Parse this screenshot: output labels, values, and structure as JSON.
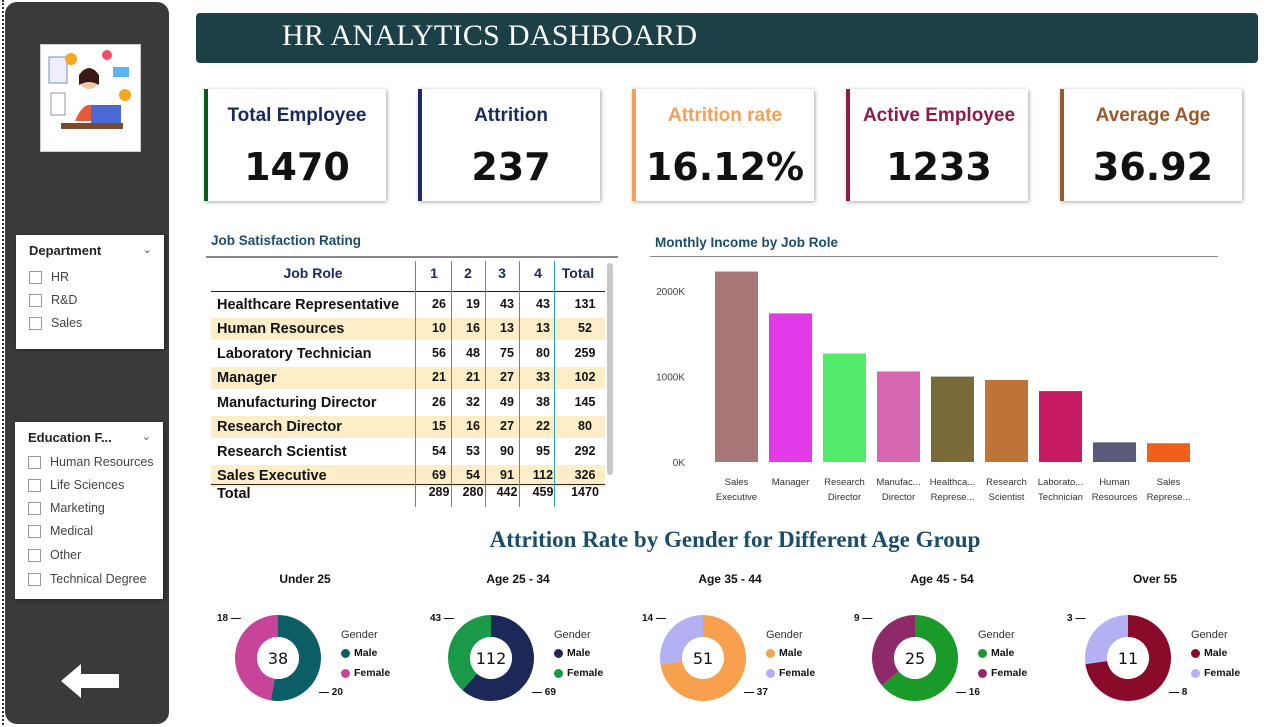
{
  "header": {
    "title": "HR ANALYTICS DASHBOARD"
  },
  "kpis": [
    {
      "label": "Total Employee",
      "value": "1470",
      "color": "#0c5a1e"
    },
    {
      "label": "Attrition",
      "value": "237",
      "color": "#1a2a6b"
    },
    {
      "label": "Attrition rate",
      "value": "16.12%",
      "color": "#f3a05a"
    },
    {
      "label": "Active Employee",
      "value": "1233",
      "color": "#8c1c4a"
    },
    {
      "label": "Average Age",
      "value": "36.92",
      "color": "#9c5a2a"
    }
  ],
  "slicers": {
    "department": {
      "title": "Department",
      "options": [
        "HR",
        "R&D",
        "Sales"
      ]
    },
    "education": {
      "title": "Education F...",
      "options": [
        "Human Resources",
        "Life Sciences",
        "Marketing",
        "Medical",
        "Other",
        "Technical Degree"
      ]
    }
  },
  "job_satisfaction": {
    "title": "Job Satisfaction Rating",
    "headers": [
      "Job Role",
      "1",
      "2",
      "3",
      "4",
      "Total"
    ],
    "rows": [
      {
        "role": "Healthcare Representative",
        "v": [
          "26",
          "19",
          "43",
          "43",
          "131"
        ]
      },
      {
        "role": "Human Resources",
        "v": [
          "10",
          "16",
          "13",
          "13",
          "52"
        ]
      },
      {
        "role": "Laboratory Technician",
        "v": [
          "56",
          "48",
          "75",
          "80",
          "259"
        ]
      },
      {
        "role": "Manager",
        "v": [
          "21",
          "21",
          "27",
          "33",
          "102"
        ]
      },
      {
        "role": "Manufacturing Director",
        "v": [
          "26",
          "32",
          "49",
          "38",
          "145"
        ]
      },
      {
        "role": "Research Director",
        "v": [
          "15",
          "16",
          "27",
          "22",
          "80"
        ]
      },
      {
        "role": "Research Scientist",
        "v": [
          "54",
          "53",
          "90",
          "95",
          "292"
        ]
      },
      {
        "role": "Sales Executive",
        "v": [
          "69",
          "54",
          "91",
          "112",
          "326"
        ]
      }
    ],
    "total": {
      "role": "Total",
      "v": [
        "289",
        "280",
        "442",
        "459",
        "1470"
      ]
    }
  },
  "chart_data": [
    {
      "type": "bar",
      "title": "Monthly Income by Job Role",
      "categories": [
        [
          "Sales",
          "Executive"
        ],
        [
          "Manager",
          ""
        ],
        [
          "Research",
          "Director"
        ],
        [
          "Manufac...",
          "Director"
        ],
        [
          "Healthca...",
          "Represe..."
        ],
        [
          "Research",
          "Scientist"
        ],
        [
          "Laborato...",
          "Technician"
        ],
        [
          "Human",
          "Resources"
        ],
        [
          "Sales",
          "Represe..."
        ]
      ],
      "values": [
        2230000,
        1740000,
        1270000,
        1060000,
        1000000,
        960000,
        830000,
        230000,
        220000
      ],
      "colors": [
        "#a87878",
        "#e23ae6",
        "#52ec6a",
        "#d666b0",
        "#7a6a38",
        "#c07338",
        "#c61a62",
        "#5a5a7a",
        "#f0601a"
      ],
      "yticks": [
        {
          "v": 0,
          "label": "0K"
        },
        {
          "v": 1000000,
          "label": "1000K"
        },
        {
          "v": 2000000,
          "label": "2000K"
        }
      ],
      "ylim": [
        0,
        2400000
      ]
    },
    {
      "type": "pie",
      "title": "Attrition Rate by Gender for Different Age Group",
      "groups": [
        {
          "title": "Under 25",
          "total": "38",
          "slices": [
            {
              "name": "Male",
              "value": 20,
              "color": "#0b5e63"
            },
            {
              "name": "Female",
              "value": 18,
              "color": "#c8439a"
            }
          ]
        },
        {
          "title": "Age 25 - 34",
          "total": "112",
          "slices": [
            {
              "name": "Male",
              "value": 69,
              "color": "#1c2858"
            },
            {
              "name": "Female",
              "value": 43,
              "color": "#1a9a48"
            }
          ]
        },
        {
          "title": "Age 35 - 44",
          "total": "51",
          "slices": [
            {
              "name": "Male",
              "value": 37,
              "color": "#f7a04e"
            },
            {
              "name": "Female",
              "value": 14,
              "color": "#b4b0f4"
            }
          ]
        },
        {
          "title": "Age 45 - 54",
          "total": "25",
          "slices": [
            {
              "name": "Male",
              "value": 16,
              "color": "#1a9a28"
            },
            {
              "name": "Female",
              "value": 9,
              "color": "#8e2a6a"
            }
          ]
        },
        {
          "title": "Over 55",
          "total": "11",
          "slices": [
            {
              "name": "Male",
              "value": 8,
              "color": "#8a0a2a"
            },
            {
              "name": "Female",
              "value": 3,
              "color": "#b4b0f4"
            }
          ]
        }
      ],
      "legend_title": "Gender"
    }
  ]
}
